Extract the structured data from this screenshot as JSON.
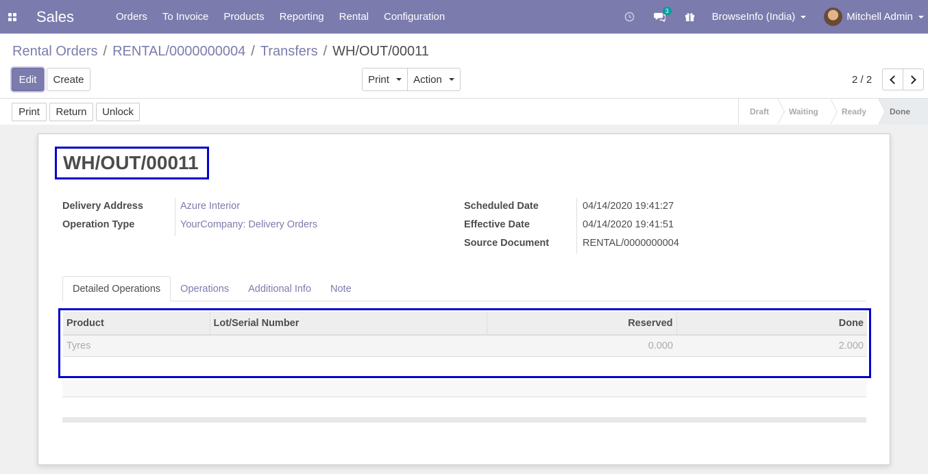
{
  "navbar": {
    "app_name": "Sales",
    "menu": [
      "Orders",
      "To Invoice",
      "Products",
      "Reporting",
      "Rental",
      "Configuration"
    ],
    "icons": [
      "clock-icon",
      "chat-icon",
      "gift-icon"
    ],
    "message_count": "3",
    "company": "BrowseInfo (India)",
    "user": "Mitchell Admin",
    "color": "#7c7bad"
  },
  "breadcrumb": {
    "items": [
      "Rental Orders",
      "RENTAL/0000000004",
      "Transfers"
    ],
    "current": "WH/OUT/00011"
  },
  "toolbar": {
    "edit": "Edit",
    "create": "Create",
    "print": "Print",
    "action": "Action",
    "pager": "2 / 2"
  },
  "status_buttons": {
    "print": "Print",
    "return": "Return",
    "unlock": "Unlock"
  },
  "stages": [
    "Draft",
    "Waiting",
    "Ready",
    "Done"
  ],
  "active_stage": "Done",
  "form": {
    "title": "WH/OUT/00011",
    "left": [
      {
        "label": "Delivery Address",
        "value": "Azure Interior"
      },
      {
        "label": "Operation Type",
        "value": "YourCompany: Delivery Orders"
      }
    ],
    "right": [
      {
        "label": "Scheduled Date",
        "value": "04/14/2020 19:41:27"
      },
      {
        "label": "Effective Date",
        "value": "04/14/2020 19:41:51"
      },
      {
        "label": "Source Document",
        "value": "RENTAL/0000000004"
      }
    ]
  },
  "tabs": [
    "Detailed Operations",
    "Operations",
    "Additional Info",
    "Note"
  ],
  "table": {
    "headers": [
      "Product",
      "Lot/Serial Number",
      "Reserved",
      "Done"
    ],
    "rows": [
      {
        "product": "Tyres",
        "lot": "",
        "reserved": "0.000",
        "done": "2.000"
      }
    ]
  }
}
